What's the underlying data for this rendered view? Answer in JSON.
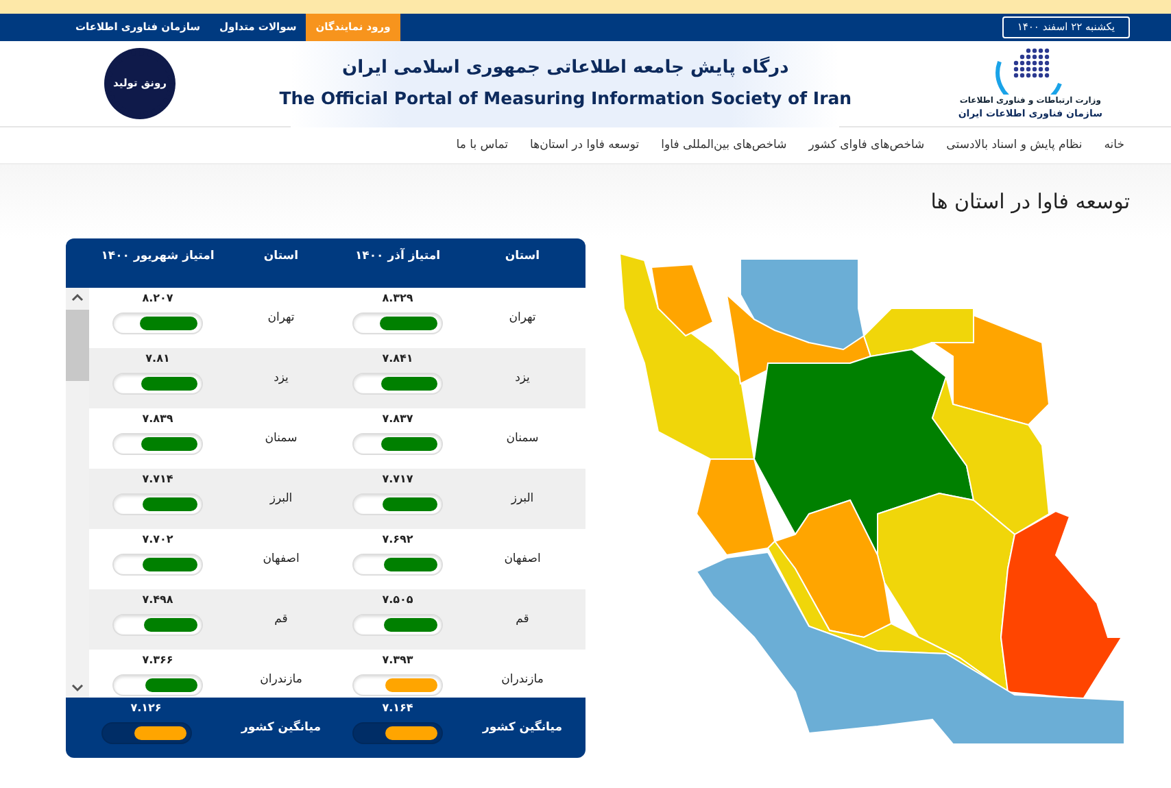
{
  "top_bar": {
    "date": "یکشنبه ۲۲ اسفند ۱۴۰۰",
    "links": [
      {
        "label": "ورود نمایندگان",
        "highlighted": true
      },
      {
        "label": "سوالات متداول",
        "highlighted": false
      },
      {
        "label": "سازمان فناوری اطلاعات",
        "highlighted": false
      }
    ]
  },
  "header": {
    "logo_lines": [
      "وزارت ارتباطات و فناوری اطلاعات",
      "سازمان فناوری اطلاعات ایران"
    ],
    "title_fa": "درگاه پایش جامعه اطلاعاتی جمهوری اسلامی ایران",
    "title_en": "The Official Portal of Measuring Information Society of Iran",
    "badge_text": "رونق تولید"
  },
  "nav": {
    "items": [
      "خانه",
      "نظام پایش و اسناد بالادستی",
      "شاخص‌های فاوای کشور",
      "شاخص‌های بین‌المللی فاوا",
      "توسعه فاوا در استان‌ها",
      "تماس با ما"
    ]
  },
  "section_title": "توسعه فاوا در استان ها",
  "table": {
    "columns": [
      "استان",
      "امتیاز آذر ۱۴۰۰",
      "استان",
      "امتیاز شهریور ۱۴۰۰"
    ],
    "rows": [
      {
        "province": "تهران",
        "azar": {
          "score": "۸.۳۲۹",
          "level": 0.73,
          "color": "#008000"
        },
        "province_2": "تهران",
        "shahrivar": {
          "score": "۸.۲۰۷",
          "level": 0.72,
          "color": "#008000"
        }
      },
      {
        "province": "یزد",
        "azar": {
          "score": "۷.۸۴۱",
          "level": 0.7,
          "color": "#008000"
        },
        "province_2": "یزد",
        "shahrivar": {
          "score": "۷.۸۱",
          "level": 0.7,
          "color": "#008000"
        }
      },
      {
        "province": "سمنان",
        "azar": {
          "score": "۷.۸۳۷",
          "level": 0.7,
          "color": "#008000"
        },
        "province_2": "سمنان",
        "shahrivar": {
          "score": "۷.۸۳۹",
          "level": 0.7,
          "color": "#008000"
        }
      },
      {
        "province": "البرز",
        "azar": {
          "score": "۷.۷۱۷",
          "level": 0.69,
          "color": "#008000"
        },
        "province_2": "البرز",
        "shahrivar": {
          "score": "۷.۷۱۴",
          "level": 0.69,
          "color": "#008000"
        }
      },
      {
        "province": "اصفهان",
        "azar": {
          "score": "۷.۶۹۲",
          "level": 0.68,
          "color": "#008000"
        },
        "province_2": "اصفهان",
        "shahrivar": {
          "score": "۷.۷۰۲",
          "level": 0.69,
          "color": "#008000"
        }
      },
      {
        "province": "قم",
        "azar": {
          "score": "۷.۵۰۵",
          "level": 0.67,
          "color": "#008000"
        },
        "province_2": "قم",
        "shahrivar": {
          "score": "۷.۴۹۸",
          "level": 0.67,
          "color": "#008000"
        }
      },
      {
        "province": "مازندران",
        "azar": {
          "score": "۷.۳۹۳",
          "level": 0.65,
          "color": "#ffa500"
        },
        "province_2": "مازندران",
        "shahrivar": {
          "score": "۷.۳۶۶",
          "level": 0.66,
          "color": "#008000"
        }
      }
    ],
    "footer": {
      "label": "میانگین کشور",
      "azar": {
        "score": "۷.۱۶۴",
        "level": 0.65,
        "color": "#ffa500"
      },
      "label_2": "میانگین کشور",
      "shahrivar": {
        "score": "۷.۱۲۶",
        "level": 0.65,
        "color": "#ffa500"
      }
    }
  }
}
